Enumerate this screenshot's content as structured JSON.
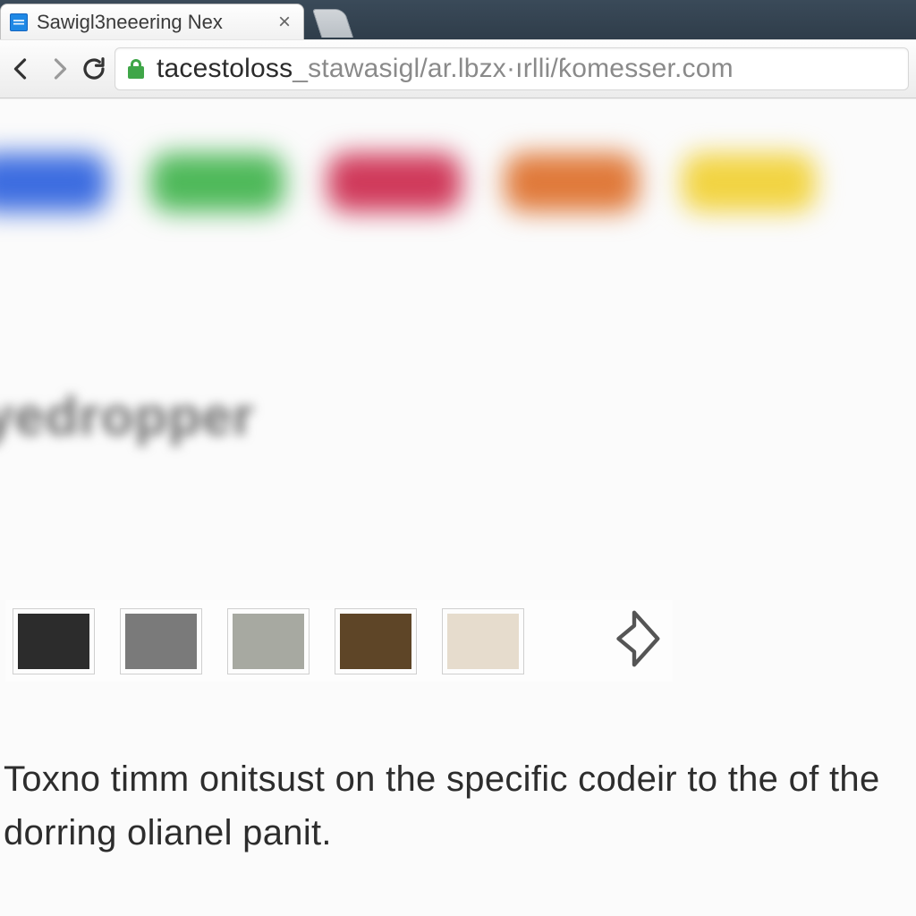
{
  "browser": {
    "tab": {
      "title": "Sawigl3neeering Nex",
      "favicon_name": "page-favicon"
    },
    "url": {
      "host": "tacestoloss",
      "path": "_stawasigl/ar.lbzx·ırlli/ƙomesser.com"
    }
  },
  "page": {
    "pill_colors": [
      "#3d6de0",
      "#4fb95a",
      "#d03a5b",
      "#e07a3b",
      "#f2d443"
    ],
    "blur_heading": "yedropper",
    "swatches": [
      "#2c2c2c",
      "#7a7a7a",
      "#a7a9a1",
      "#5e4527",
      "#e6dccd"
    ],
    "body_text": "Toxno timm onitsust on the specific codeir to the of the dorring olianel panit."
  }
}
